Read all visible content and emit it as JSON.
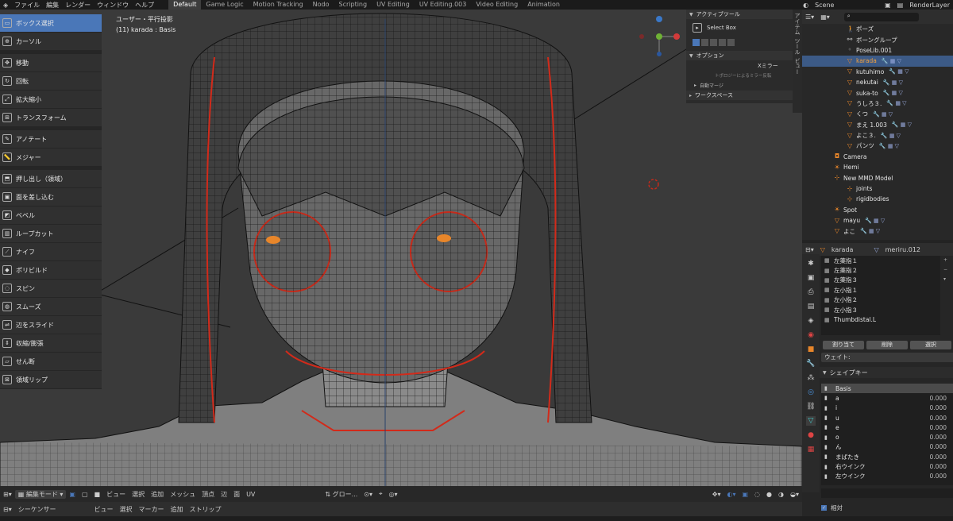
{
  "menubar": {
    "items": [
      "ファイル",
      "編集",
      "レンダー",
      "ウィンドウ",
      "ヘルプ"
    ],
    "workspaces": [
      "Default",
      "Game Logic",
      "Motion Tracking",
      "Nodo",
      "Scripting",
      "UV Editing",
      "UV Editing.003",
      "Video Editing",
      "Animation"
    ],
    "active_workspace": "Default",
    "scene": "Scene",
    "render_layer": "RenderLayer"
  },
  "toolbar": {
    "tools": [
      "ボックス選択",
      "カーソル",
      "移動",
      "回転",
      "拡大縮小",
      "トランスフォーム",
      "アノテート",
      "メジャー",
      "押し出し（領域）",
      "面を差し込む",
      "ベベル",
      "ループカット",
      "ナイフ",
      "ポリビルド",
      "スピン",
      "スムーズ",
      "辺をスライド",
      "収縮/膨張",
      "せん断",
      "領域リップ"
    ],
    "active": "ボックス選択"
  },
  "viewport": {
    "view_name": "ユーザー・平行投影",
    "object_info": "(11) karada : Basis"
  },
  "tool_settings": {
    "active_tool_header": "アクティブツール",
    "tool_name": "Select Box",
    "options_header": "オプション",
    "x_mirror": "Xミラー",
    "topology_mirror": "トポロジーによるミラー反転",
    "auto_merge": "自動マージ",
    "workspace_header": "ワークスペース"
  },
  "vertical_tabs": [
    "アイテム",
    "ツール",
    "ビュー"
  ],
  "viewport_footer": {
    "mode": "編集モード",
    "menus": [
      "ビュー",
      "選択",
      "追加",
      "メッシュ",
      "頂点",
      "辺",
      "面",
      "UV"
    ],
    "transform": "グロー..."
  },
  "sequencer": {
    "editor": "シーケンサー",
    "menus": [
      "ビュー",
      "選択",
      "マーカー",
      "追加",
      "ストリップ"
    ]
  },
  "outliner": {
    "items": [
      {
        "label": "ポーズ",
        "indent": 1,
        "icon": "pose-icon"
      },
      {
        "label": "ボーングループ",
        "indent": 1,
        "icon": "bone-group-icon"
      },
      {
        "label": "PoseLib.001",
        "indent": 1,
        "icon": "poselib-icon"
      },
      {
        "label": "karada",
        "indent": 1,
        "icon": "mesh-icon",
        "selected": true
      },
      {
        "label": "kutuhimo",
        "indent": 1,
        "icon": "mesh-icon"
      },
      {
        "label": "nekutai",
        "indent": 1,
        "icon": "mesh-icon"
      },
      {
        "label": "suka-to",
        "indent": 1,
        "icon": "mesh-icon"
      },
      {
        "label": "うしろ３.",
        "indent": 1,
        "icon": "mesh-icon"
      },
      {
        "label": "くつ",
        "indent": 1,
        "icon": "mesh-icon"
      },
      {
        "label": "まえ 1.003",
        "indent": 1,
        "icon": "mesh-icon"
      },
      {
        "label": "よこ３.",
        "indent": 1,
        "icon": "mesh-icon"
      },
      {
        "label": "パンツ",
        "indent": 1,
        "icon": "mesh-icon"
      },
      {
        "label": "Camera",
        "indent": 0,
        "icon": "camera-icon"
      },
      {
        "label": "Hemi",
        "indent": 0,
        "icon": "light-icon"
      },
      {
        "label": "New MMD Model",
        "indent": 0,
        "icon": "empty-icon"
      },
      {
        "label": "joints",
        "indent": 1,
        "icon": "empty-icon"
      },
      {
        "label": "rigidbodies",
        "indent": 1,
        "icon": "empty-icon"
      },
      {
        "label": "Spot",
        "indent": 0,
        "icon": "light-icon"
      },
      {
        "label": "mayu",
        "indent": 0,
        "icon": "mesh-icon"
      },
      {
        "label": "よこ",
        "indent": 0,
        "icon": "mesh-icon"
      }
    ]
  },
  "properties": {
    "object": "karada",
    "mesh": "meriru.012",
    "vertex_groups": [
      "左薬指１",
      "左薬指２",
      "左薬指３",
      "左小指１",
      "左小指２",
      "左小指３",
      "Thumbdistal.L"
    ],
    "buttons": {
      "assign": "割り当て",
      "remove": "削除",
      "select": "選択"
    },
    "weight_label": "ウェイト:",
    "shape_keys_header": "シェイプキー",
    "shape_keys": [
      {
        "name": "Basis",
        "value": ""
      },
      {
        "name": "a",
        "value": "0.000"
      },
      {
        "name": "i",
        "value": "0.000"
      },
      {
        "name": "u",
        "value": "0.000"
      },
      {
        "name": "e",
        "value": "0.000"
      },
      {
        "name": "o",
        "value": "0.000"
      },
      {
        "name": "ん",
        "value": "0.000"
      },
      {
        "name": "まばたき",
        "value": "0.000"
      },
      {
        "name": "右ウインク",
        "value": "0.000"
      },
      {
        "name": "左ウインク",
        "value": "0.000"
      }
    ],
    "relative_label": "相対"
  },
  "colors": {
    "accent": "#4a77b8",
    "mesh_orange": "#e8862a",
    "seam_red": "#d22a1a",
    "select_blue": "#3c5a86"
  }
}
